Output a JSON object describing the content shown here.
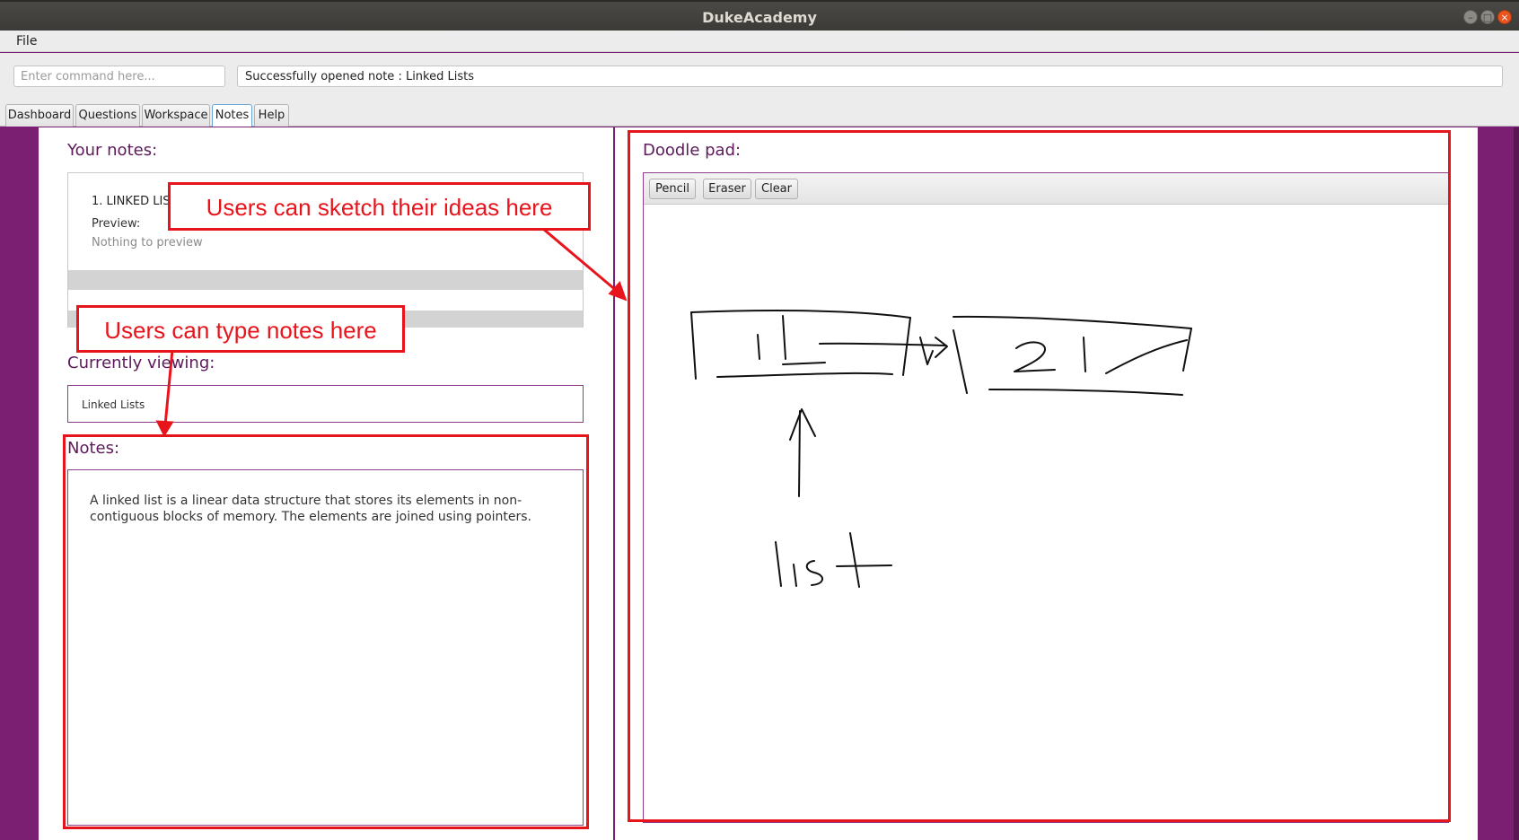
{
  "window": {
    "title": "DukeAcademy",
    "controls": [
      "–",
      "□",
      "×"
    ]
  },
  "menu": {
    "file_label": "File"
  },
  "command": {
    "placeholder": "Enter command here...",
    "result": "Successfully opened note : Linked Lists"
  },
  "tabs": [
    {
      "label": "Dashboard"
    },
    {
      "label": "Questions"
    },
    {
      "label": "Workspace"
    },
    {
      "label": "Notes",
      "active": true
    },
    {
      "label": "Help"
    }
  ],
  "left": {
    "your_notes_heading": "Your notes:",
    "note_item": {
      "title": "1.  LINKED LISTS",
      "preview_label": "Preview:",
      "preview_text": "Nothing to preview"
    },
    "currently_viewing_heading": "Currently viewing:",
    "currently_viewing_value": "Linked Lists",
    "notes_heading": "Notes:",
    "notes_content": "A linked list is a linear data structure that stores its elements in non-contiguous blocks of memory. The elements are joined using pointers."
  },
  "right": {
    "doodle_heading": "Doodle pad:",
    "tools": [
      "Pencil",
      "Eraser",
      "Clear"
    ]
  },
  "annotations": {
    "sketch_label": "Users can sketch their ideas here",
    "type_label": "Users can type notes here",
    "color": "#e8141c"
  },
  "colors": {
    "accent": "#7a1f72",
    "heading": "#5c1a5a"
  }
}
